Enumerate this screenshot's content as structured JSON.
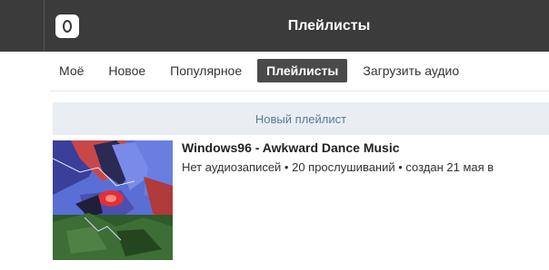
{
  "header": {
    "title": "Плейлисты",
    "logo_icon": "app-logo-icon",
    "background": "#3b3b3b"
  },
  "tabs": [
    {
      "label": "Моё",
      "active": false
    },
    {
      "label": "Новое",
      "active": false
    },
    {
      "label": "Популярное",
      "active": false
    },
    {
      "label": "Плейлисты",
      "active": true
    },
    {
      "label": "Загрузить аудио",
      "active": false
    }
  ],
  "new_playlist": {
    "label": "Новый плейлист"
  },
  "playlists": [
    {
      "title": "Windows96 - Awkward Dance Music",
      "meta": "Нет аудиозаписей • 20 прослушиваний • создан 21 мая в"
    }
  ],
  "colors": {
    "accent": "#5b7a9a",
    "button_bg": "#e9eef2",
    "active_tab": "#4a4a4a"
  }
}
